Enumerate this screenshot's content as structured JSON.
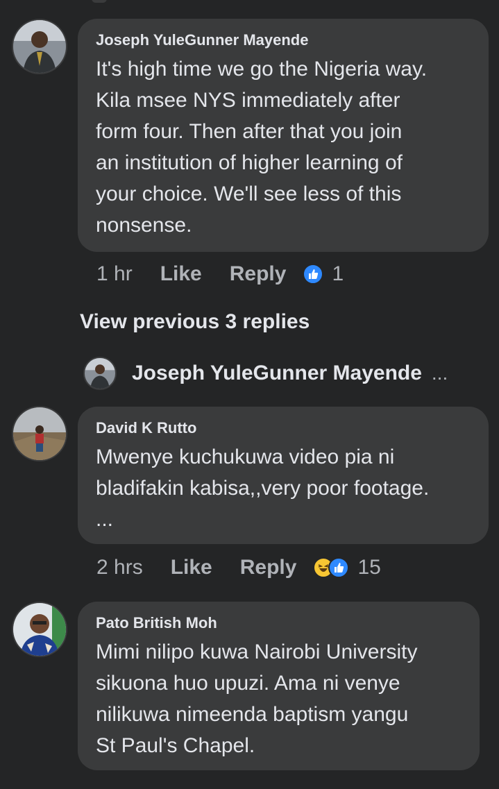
{
  "comments": [
    {
      "author": "Joseph YuleGunner Mayende",
      "text": "It's high time we go the Nigeria way.\nKila msee NYS immediately after\nform four. Then after that you join\nan institution of higher learning of\nyour choice. We'll see less of this\nnonsense.",
      "time": "1 hr",
      "like_label": "Like",
      "reply_label": "Reply",
      "reaction_count": "1",
      "reactions": [
        "like-icon"
      ]
    },
    {
      "author": "David K Rutto",
      "text": "Mwenye kuchukuwa video pia ni\nbladifakin kabisa,,very poor footage.\n...",
      "time": "2 hrs",
      "like_label": "Like",
      "reply_label": "Reply",
      "reaction_count": "15",
      "reactions": [
        "haha-icon",
        "like-icon"
      ]
    },
    {
      "author": "Pato British Moh",
      "text": "Mimi nilipo kuwa Nairobi University\nsikuona huo upuzi. Ama ni venye\nnilikuwa nimeenda baptism yangu\nSt Paul's Chapel."
    }
  ],
  "view_previous": "View previous 3 replies",
  "reply_preview": {
    "author": "Joseph YuleGunner Mayende",
    "more": "..."
  },
  "colors": {
    "background": "#242526",
    "bubble": "#3a3b3c",
    "text": "#e4e6eb",
    "secondary": "#b0b3b8",
    "like_blue": "#2e89ff",
    "haha_yellow": "#f7c633"
  }
}
